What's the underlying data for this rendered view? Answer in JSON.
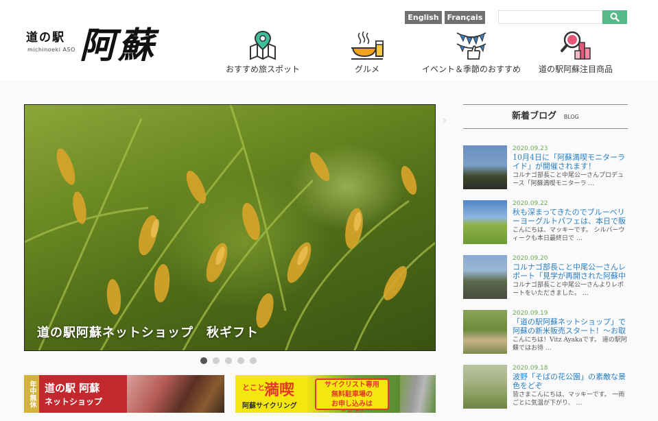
{
  "header": {
    "logo_small": "道の駅",
    "logo_sub": "michinoeki ASO",
    "logo_big": "阿蘇",
    "lang": [
      "English",
      "Français"
    ],
    "search": {
      "value": "",
      "placeholder": ""
    },
    "nav": [
      {
        "label": "おすすめ旅スポット",
        "icon": "map-pin-icon"
      },
      {
        "label": "グルメ",
        "icon": "food-drink-icon"
      },
      {
        "label": "イベント＆季節のおすすめ",
        "icon": "bunting-thumbsup-icon"
      },
      {
        "label": "道の駅阿蘇注目商品",
        "icon": "magnifier-products-icon"
      }
    ]
  },
  "slider": {
    "caption": "道の駅阿蘇ネットショップ　秋ギフト",
    "dot_count": 5,
    "active_dot": 1
  },
  "banners": {
    "shop": {
      "tag": "年中無休",
      "line1": "道の駅 阿蘇",
      "line2": "ネットショップ"
    },
    "cycling": {
      "small": "とことん",
      "big": "満喫",
      "sub": "阿蘇サイクリング",
      "box": "サイクリスト専用\n無料駐車場の\nお申し込みは\nこちら!"
    }
  },
  "blog": {
    "heading": "新着ブログ",
    "heading_sub": "BLOG",
    "items": [
      {
        "date": "2020.09.23",
        "title": "10月4日に「阿蘇満喫モニターライド」が開催されます！",
        "excerpt": "コルナゴ部長こと中尾公一さんプロデュース「阿蘇満喫モニターラ …",
        "thumb": [
          "#6a8fc0",
          "#7aa0c8",
          "#3d4a2a"
        ]
      },
      {
        "date": "2020.09.22",
        "title": "秋も深まってきたのでブルーベリーヨーグルトパフェは、本日で販売終了",
        "excerpt": "こんにちは、マッキーです。 シルバーウィークも本日最終日で …",
        "thumb": [
          "#4f86c6",
          "#8fb24a",
          "#6e9a34"
        ]
      },
      {
        "date": "2020.09.20",
        "title": "コルナゴ部長こと中尾公一さんレポート「見学が再開された阿蘇中岳",
        "excerpt": "コルナゴ部長こと中尾公一さんよりレポートをいただきました。 …",
        "thumb": [
          "#8aa9cf",
          "#5a6a4a",
          "#4a4a42"
        ]
      },
      {
        "date": "2020.09.19",
        "title": "「道の駅阿蘇ネットショップ」で阿蘇の新米販売スタート！～お取",
        "excerpt": "こんにちは！Vitz Ayakaです。 道の駅阿蘇ではお待 …",
        "thumb": [
          "#8aa45a",
          "#6b8a3a",
          "#c9b38a"
        ]
      },
      {
        "date": "2020.09.18",
        "title": "波野「そばの花公園」の素敵な景色をどぞ",
        "excerpt": "皆さまこんにちは、マッキーです。 一雨ごとに気温が下がり、 …",
        "thumb": [
          "#b8c4a0",
          "#8ea062",
          "#6e8444"
        ]
      }
    ]
  }
}
